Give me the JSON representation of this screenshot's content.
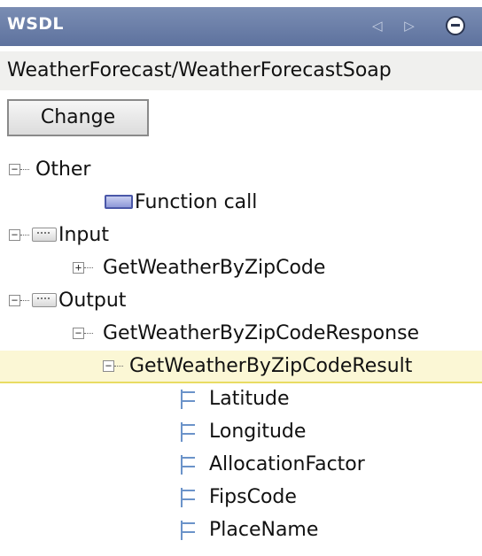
{
  "header": {
    "title": "WSDL",
    "nav_arrows": "◁ ▷"
  },
  "url": "WeatherForecast/WeatherForecastSoap",
  "change_label": "Change",
  "tree": {
    "other": "Other",
    "function_call": "Function call",
    "input": "Input",
    "get_weather_by_zip": "GetWeatherByZipCode",
    "output": "Output",
    "response": "GetWeatherByZipCodeResponse",
    "result": "GetWeatherByZipCodeResult",
    "fields": [
      "Latitude",
      "Longitude",
      "AllocationFactor",
      "FipsCode",
      "PlaceName"
    ]
  },
  "expander_symbols": {
    "expanded": "−",
    "collapsed": "+"
  },
  "colors": {
    "header_bg": "#6a7ea8",
    "selected_bg": "#fbf7d5",
    "selected_border": "#e9dc63",
    "field_icon": "#6b93c9"
  }
}
